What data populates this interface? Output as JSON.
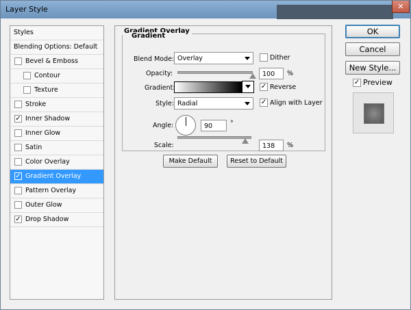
{
  "window": {
    "title": "Layer Style",
    "close_glyph": "✕"
  },
  "styles_list": {
    "header": "Styles",
    "blending_options": "Blending Options: Default",
    "items": [
      {
        "label": "Bevel & Emboss",
        "checked": false,
        "indent": false
      },
      {
        "label": "Contour",
        "checked": false,
        "indent": true
      },
      {
        "label": "Texture",
        "checked": false,
        "indent": true
      },
      {
        "label": "Stroke",
        "checked": false,
        "indent": false
      },
      {
        "label": "Inner Shadow",
        "checked": true,
        "indent": false
      },
      {
        "label": "Inner Glow",
        "checked": false,
        "indent": false
      },
      {
        "label": "Satin",
        "checked": false,
        "indent": false
      },
      {
        "label": "Color Overlay",
        "checked": false,
        "indent": false
      },
      {
        "label": "Gradient Overlay",
        "checked": true,
        "indent": false,
        "selected": true
      },
      {
        "label": "Pattern Overlay",
        "checked": false,
        "indent": false
      },
      {
        "label": "Outer Glow",
        "checked": false,
        "indent": false
      },
      {
        "label": "Drop Shadow",
        "checked": true,
        "indent": false
      }
    ],
    "check_glyph": "✓"
  },
  "panel": {
    "title": "Gradient Overlay",
    "group_title": "Gradient",
    "blend_mode_label": "Blend Mode:",
    "blend_mode_value": "Overlay",
    "dither_label": "Dither",
    "dither_checked": false,
    "opacity_label": "Opacity:",
    "opacity_value": "100",
    "opacity_percent": 100,
    "percent_sign": "%",
    "gradient_label": "Gradient:",
    "reverse_label": "Reverse",
    "reverse_checked": true,
    "style_label": "Style:",
    "style_value": "Radial",
    "align_label": "Align with Layer",
    "align_checked": true,
    "angle_label": "Angle:",
    "angle_value": "90",
    "degree_sign": "°",
    "scale_label": "Scale:",
    "scale_value": "138",
    "scale_percent": 138,
    "make_default": "Make Default",
    "reset_default": "Reset to Default"
  },
  "right": {
    "ok": "OK",
    "cancel": "Cancel",
    "new_style": "New Style...",
    "preview_label": "Preview",
    "preview_checked": true
  },
  "colors": {
    "selection": "#3399ff",
    "titlebar": "#7ea3c9"
  }
}
